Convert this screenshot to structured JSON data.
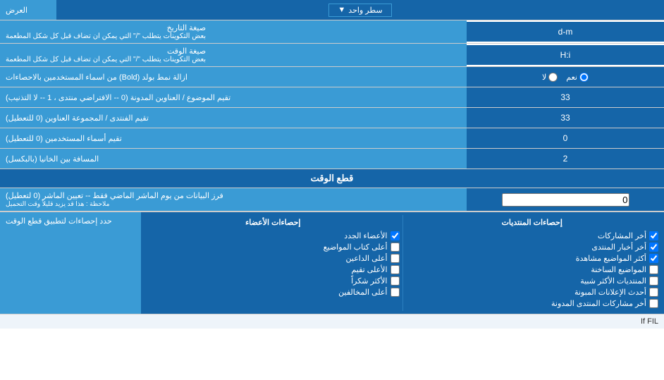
{
  "top": {
    "label": "العرض",
    "dropdown_value": "سطر واحد",
    "dropdown_arrow": "▼"
  },
  "rows": [
    {
      "id": "date-format",
      "label": "صيغة التاريخ",
      "sublabel": "بعض التكوينات يتطلب \"/\" التي يمكن ان تضاف قبل كل شكل المطعمة",
      "input_value": "d-m",
      "type": "text"
    },
    {
      "id": "time-format",
      "label": "صيغة الوقت",
      "sublabel": "بعض التكوينات يتطلب \"/\" التي يمكن ان تضاف قبل كل شكل المطعمة",
      "input_value": "H:i",
      "type": "text"
    },
    {
      "id": "bold-remove",
      "label": "ازالة نمط بولد (Bold) من اسماء المستخدمين بالاحصاءات",
      "type": "radio",
      "radio_options": [
        {
          "value": "yes",
          "label": "نعم",
          "checked": true
        },
        {
          "value": "no",
          "label": "لا",
          "checked": false
        }
      ]
    },
    {
      "id": "topic-pagination",
      "label": "تقيم الموضوع / العناوين المدونة (0 -- الافتراضي منتدى ، 1 -- لا التذنيب)",
      "input_value": "33",
      "type": "text"
    },
    {
      "id": "forum-pagination",
      "label": "تقيم الفنتدى / المجموعة العناوين (0 للتعطيل)",
      "input_value": "33",
      "type": "text"
    },
    {
      "id": "user-names",
      "label": "تقيم أسماء المستخدمين (0 للتعطيل)",
      "input_value": "0",
      "type": "text"
    },
    {
      "id": "gap-pages",
      "label": "المسافة بين الخانيا (بالبكسل)",
      "input_value": "2",
      "type": "text"
    }
  ],
  "cutoff_section": {
    "header": "قطع الوقت",
    "row": {
      "label": "فرز البيانات من يوم الماشر الماضي فقط -- تعيين الماشر (0 لتعطيل)",
      "sublabel": "ملاحظة : هذا قد يزيد قليلاً وقت التحميل",
      "input_value": "0"
    }
  },
  "stats_section": {
    "label": "حدد إحصاءات لتطبيق قطع الوقت",
    "col1_header": "إحصاءات المنتديات",
    "col1_items": [
      {
        "label": "أخر المشاركات",
        "checked": true
      },
      {
        "label": "أخر أخبار المنتدى",
        "checked": true
      },
      {
        "label": "أكثر المواضيع مشاهدة",
        "checked": true
      },
      {
        "label": "المواضيع الساخنة",
        "checked": false
      },
      {
        "label": "المنتديات الأكثر شبية",
        "checked": false
      },
      {
        "label": "أحدث الإعلانات المبونة",
        "checked": false
      },
      {
        "label": "أخر مشاركات المنتدى المدونة",
        "checked": false
      }
    ],
    "col2_header": "إحصاءات الأعضاء",
    "col2_items": [
      {
        "label": "الأعضاء الجدد",
        "checked": true
      },
      {
        "label": "أعلى كتاب المواضيع",
        "checked": false
      },
      {
        "label": "أعلى الداعين",
        "checked": false
      },
      {
        "label": "الأعلى تقيم",
        "checked": false
      },
      {
        "label": "الأكثر شكراً",
        "checked": false
      },
      {
        "label": "أعلى المخالفين",
        "checked": false
      }
    ]
  },
  "bottom_text": "If FIL"
}
